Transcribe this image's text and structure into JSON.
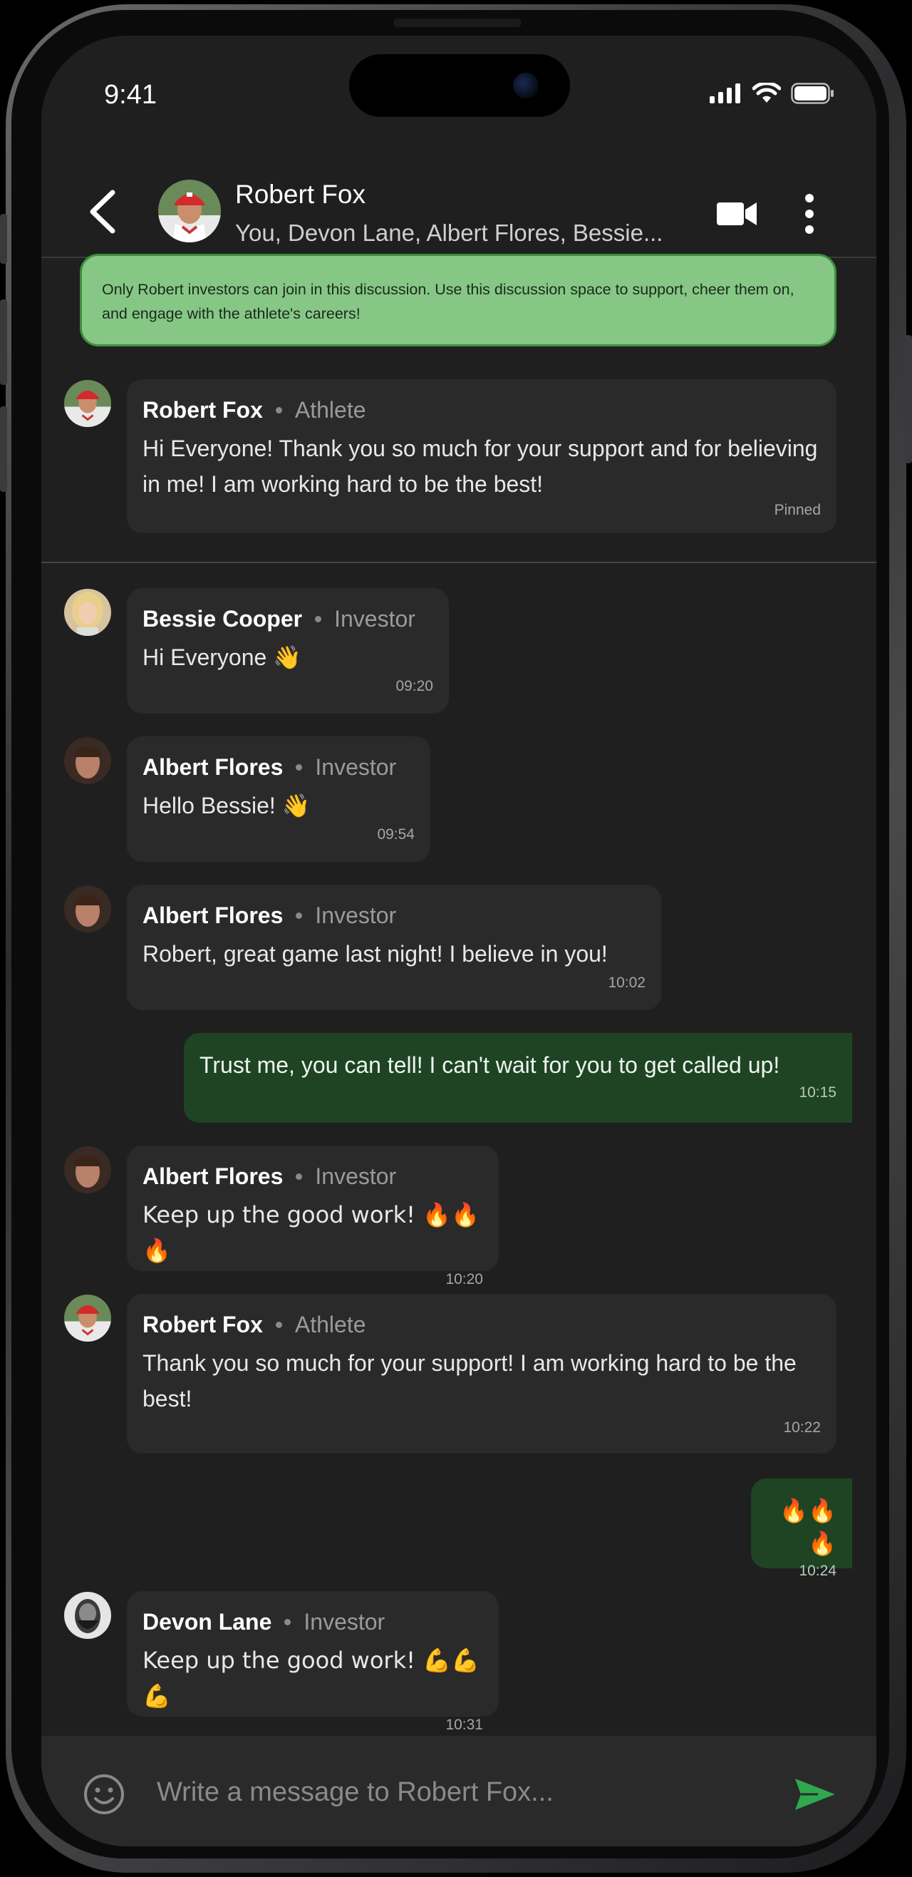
{
  "status_bar": {
    "time": "9:41"
  },
  "header": {
    "title": "Robert Fox",
    "subtitle": "You, Devon Lane, Albert Flores, Bessie..."
  },
  "banner": {
    "text": "Only Robert investors can join in this discussion. Use this discussion space to support, cheer them on, and engage with the athlete's careers!"
  },
  "pinned": {
    "author": "Robert Fox",
    "role": "Athlete",
    "text": "Hi Everyone! Thank you so much for your support and for believing in me! I am working hard to be the best!",
    "label": "Pinned"
  },
  "messages": [
    {
      "author": "Bessie Cooper",
      "role": "Investor",
      "text": "Hi Everyone 👋",
      "time": "09:20"
    },
    {
      "author": "Albert Flores",
      "role": "Investor",
      "text": "Hello Bessie! 👋",
      "time": "09:54"
    },
    {
      "author": "Albert Flores",
      "role": "Investor",
      "text": "Robert, great game last night! I believe in you!",
      "time": "10:02"
    },
    {
      "mine": true,
      "text": "Trust me, you can tell! I can't wait for you to get called up!",
      "time": "10:15"
    },
    {
      "author": "Albert Flores",
      "role": "Investor",
      "text": "Keep up the good work! 🔥🔥🔥",
      "time": "10:20"
    },
    {
      "author": "Robert Fox",
      "role": "Athlete",
      "text": "Thank you so much for your support! I am working hard to be the best!",
      "time": "10:22"
    },
    {
      "mine": true,
      "text": "🔥🔥🔥",
      "time": "10:24"
    },
    {
      "author": "Devon Lane",
      "role": "Investor",
      "text": "Keep up the good work! 💪💪💪",
      "time": "10:31"
    }
  ],
  "composer": {
    "placeholder": "Write a message to Robert Fox..."
  },
  "colors": {
    "background": "#1f1f1f",
    "bubble": "#2a2a2a",
    "my_bubble": "#1e4424",
    "banner": "#86c786",
    "send_accent": "#2fa84f"
  },
  "icons": [
    "back-icon",
    "video-call-icon",
    "more-options-icon",
    "emoji-icon",
    "send-icon",
    "signal-icon",
    "wifi-icon",
    "battery-icon"
  ]
}
